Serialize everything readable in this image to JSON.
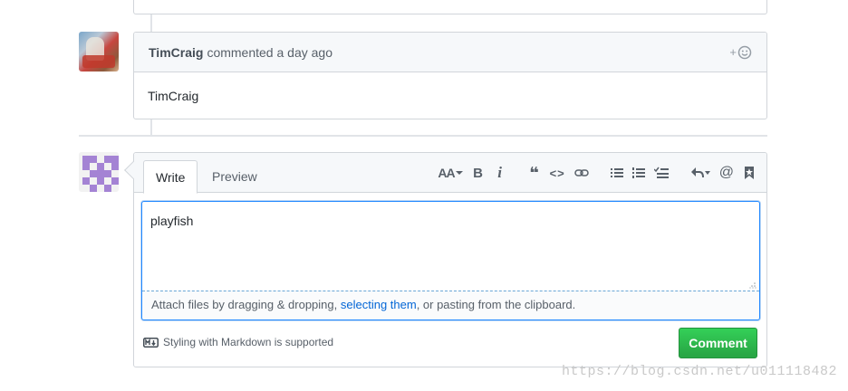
{
  "comment": {
    "author": "TimCraig",
    "action": "commented",
    "time": "a day ago",
    "reaction_plus": "+",
    "body": "TimCraig"
  },
  "form": {
    "tabs": [
      "Write",
      "Preview"
    ],
    "toolbar": {
      "header": "AA",
      "bold": "B",
      "italic": "i",
      "quote": "❝",
      "code": "<>",
      "mention": "@"
    },
    "editor_value": "playfish",
    "attach": {
      "prefix": "Attach files by dragging & dropping, ",
      "link": "selecting them",
      "suffix": ", or pasting from the clipboard."
    },
    "markdown_note": "Styling with Markdown is supported",
    "submit_label": "Comment"
  },
  "watermark": "https://blog.csdn.net/u011118482",
  "colors": {
    "accent": "#0366d6",
    "button_green": "#28a745",
    "identicon": "#a483d4"
  }
}
